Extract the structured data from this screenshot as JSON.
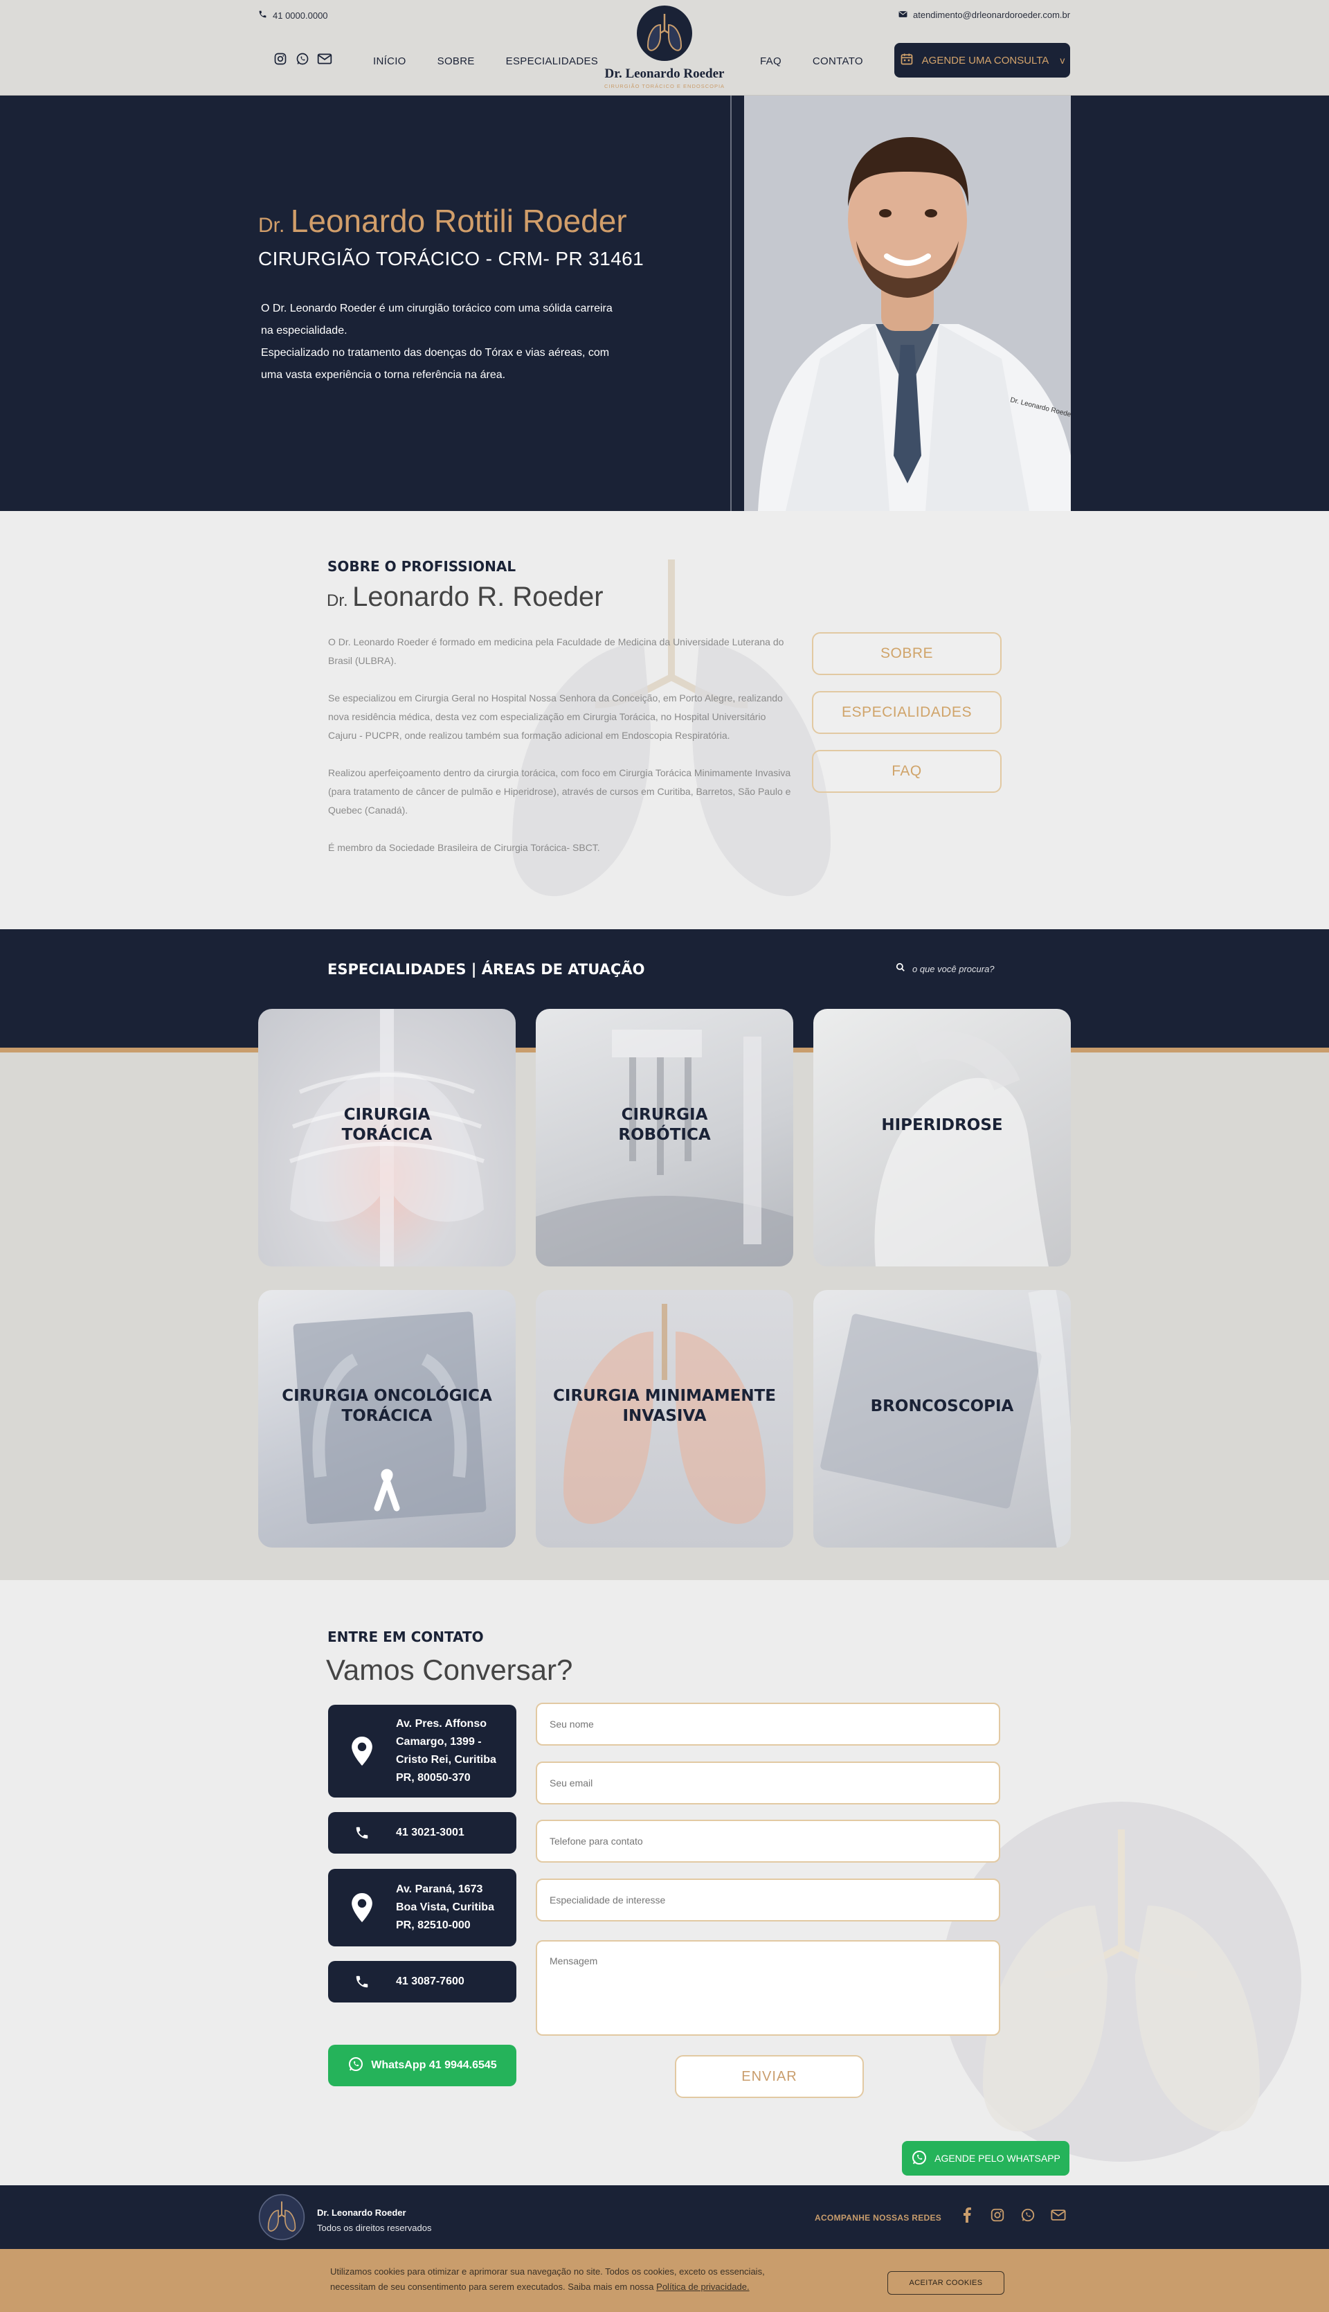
{
  "header": {
    "phone": "41 0000.0000",
    "email": "atendimento@drleonardoroeder.com.br",
    "nav_left": [
      "INÍCIO",
      "SOBRE",
      "ESPECIALIDADES"
    ],
    "nav_right": [
      "FAQ",
      "CONTATO"
    ],
    "logo_name": "Dr. Leonardo Roeder",
    "logo_tagline": "CIRURGIÃO TORÁCICO E ENDOSCOPIA",
    "cta_label": "AGENDE UMA CONSULTA",
    "cta_caret": "v"
  },
  "hero": {
    "prefix": "Dr.",
    "name": "Leonardo Rottili Roeder",
    "subtitle": "CIRURGIÃO TORÁCICO - CRM- PR 31461",
    "paragraph_lines": [
      "O Dr. Leonardo Roeder é um cirurgião torácico com uma sólida carreira",
      "na especialidade.",
      "Especializado no tratamento das doenças do Tórax e vias aéreas, com",
      "uma vasta experiência o torna referência na área."
    ],
    "coat_label": "Dr. Leonardo Roeder"
  },
  "about": {
    "kicker": "SOBRE O PROFISSIONAL",
    "prefix": "Dr.",
    "name": "Leonardo R. Roeder",
    "paragraphs": [
      "O Dr. Leonardo Roeder é formado em medicina pela Faculdade de Medicina da Universidade Luterana do Brasil (ULBRA).",
      "Se especializou em Cirurgia Geral no Hospital Nossa Senhora da Conceição, em Porto Alegre, realizando nova residência médica, desta vez com especialização em Cirurgia Torácica, no Hospital Universitário Cajuru - PUCPR, onde realizou também sua formação adicional em Endoscopia Respiratória.",
      "Realizou aperfeiçoamento dentro da cirurgia torácica, com foco em Cirurgia Torácica Minimamente Invasiva (para tratamento de câncer de pulmão e Hiperidrose), através de cursos em Curitiba, Barretos, São Paulo e Quebec (Canadá).",
      "É membro da Sociedade Brasileira de Cirurgia Torácica- SBCT."
    ],
    "buttons": [
      "SOBRE",
      "ESPECIALIDADES",
      "FAQ"
    ]
  },
  "specialties": {
    "title": "ESPECIALIDADES | ÁREAS DE ATUAÇÃO",
    "search_placeholder": "o que você procura?",
    "cards": [
      {
        "line1": "CIRURGIA",
        "line2": "TORÁCICA"
      },
      {
        "line1": "CIRURGIA",
        "line2": "ROBÓTICA"
      },
      {
        "line1": "HIPERIDROSE",
        "line2": ""
      },
      {
        "line1": "CIRURGIA ONCOLÓGICA",
        "line2": "TORÁCICA"
      },
      {
        "line1": "CIRURGIA MINIMAMENTE",
        "line2": "INVASIVA"
      },
      {
        "line1": "BRONCOSCOPIA",
        "line2": ""
      }
    ]
  },
  "contact": {
    "kicker": "ENTRE EM CONTATO",
    "title": "Vamos Conversar?",
    "addr1": [
      "Av. Pres. Affonso",
      "Camargo, 1399 -",
      "Cristo Rei, Curitiba",
      "PR, 80050-370"
    ],
    "phone1": "41 3021-3001",
    "addr2": [
      "Av. Paraná, 1673",
      "Boa Vista, Curitiba",
      "PR, 82510-000"
    ],
    "phone2": "41 3087-7600",
    "whatsapp": "WhatsApp 41 9944.6545",
    "placeholders": {
      "name": "Seu nome",
      "email": "Seu email",
      "phone": "Telefone para contato",
      "specialty": "Especialidade de interesse",
      "message": "Mensagem"
    },
    "submit": "ENVIAR",
    "whatsapp_float": "AGENDE PELO WHATSAPP"
  },
  "footer": {
    "name": "Dr. Leonardo Roeder",
    "rights": "Todos os direitos reservados",
    "follow": "ACOMPANHE NOSSAS REDES"
  },
  "cookie": {
    "line1": "Utilizamos cookies para otimizar e aprimorar sua navegação no site. Todos os cookies, exceto os essenciais,",
    "line2": "necessitam de seu consentimento para serem executados. Saiba mais em nossa",
    "link": "Política de privacidade.",
    "button": "ACEITAR COOKIES"
  },
  "colors": {
    "navy": "#1a2236",
    "gold": "#c99d6c",
    "whatsapp_green": "#25b35a"
  }
}
